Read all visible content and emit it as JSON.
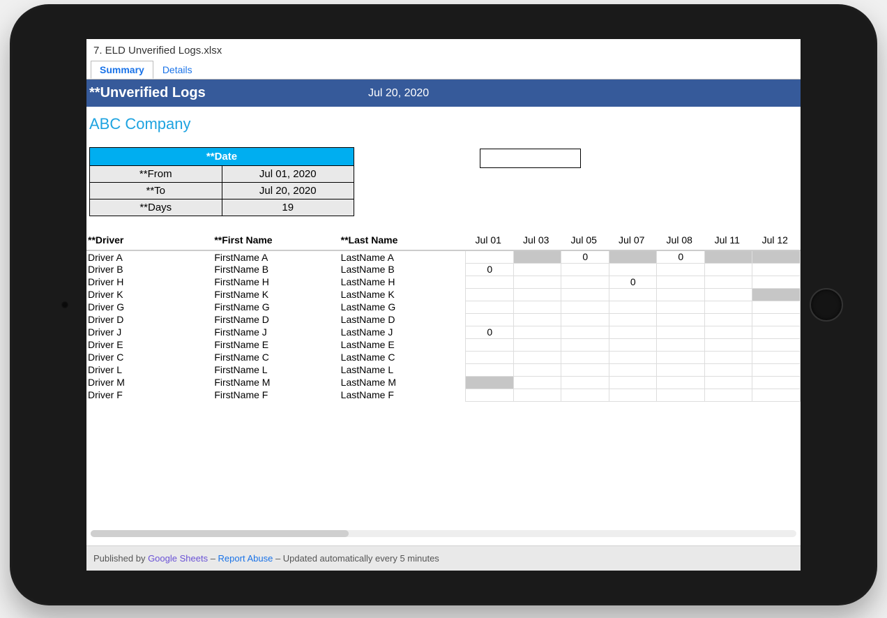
{
  "doc_title": "7. ELD Unverified Logs.xlsx",
  "tabs": {
    "summary": "Summary",
    "details": "Details"
  },
  "header": {
    "title": "**Unverified Logs",
    "date": "Jul 20, 2020"
  },
  "company": "ABC Company",
  "date_table": {
    "header": "**Date",
    "from_label": "**From",
    "from_value": "Jul 01, 2020",
    "to_label": "**To",
    "to_value": "Jul 20, 2020",
    "days_label": "**Days",
    "days_value": "19"
  },
  "grid": {
    "headers": {
      "driver": "**Driver",
      "first": "**First Name",
      "last": "**Last Name",
      "dates": [
        "Jul 01",
        "Jul 03",
        "Jul 05",
        "Jul 07",
        "Jul 08",
        "Jul 11",
        "Jul 12"
      ]
    },
    "rows": [
      {
        "driver": "Driver A",
        "first": "FirstName A",
        "last": "LastName A",
        "cells": [
          {
            "v": ""
          },
          {
            "v": "",
            "s": true
          },
          {
            "v": "0"
          },
          {
            "v": "",
            "s": true
          },
          {
            "v": "0"
          },
          {
            "v": "",
            "s": true
          },
          {
            "v": "",
            "s": true
          }
        ]
      },
      {
        "driver": "Driver B",
        "first": "FirstName B",
        "last": "LastName B",
        "cells": [
          {
            "v": "0"
          },
          {
            "v": ""
          },
          {
            "v": ""
          },
          {
            "v": ""
          },
          {
            "v": ""
          },
          {
            "v": ""
          },
          {
            "v": ""
          }
        ]
      },
      {
        "driver": "Driver H",
        "first": "FirstName H",
        "last": "LastName H",
        "cells": [
          {
            "v": ""
          },
          {
            "v": ""
          },
          {
            "v": ""
          },
          {
            "v": "0"
          },
          {
            "v": ""
          },
          {
            "v": ""
          },
          {
            "v": ""
          }
        ]
      },
      {
        "driver": "Driver K",
        "first": "FirstName K",
        "last": "LastName K",
        "cells": [
          {
            "v": ""
          },
          {
            "v": ""
          },
          {
            "v": ""
          },
          {
            "v": ""
          },
          {
            "v": ""
          },
          {
            "v": ""
          },
          {
            "v": "",
            "s": true
          }
        ]
      },
      {
        "driver": "Driver G",
        "first": "FirstName G",
        "last": "LastName G",
        "cells": [
          {
            "v": ""
          },
          {
            "v": ""
          },
          {
            "v": ""
          },
          {
            "v": ""
          },
          {
            "v": ""
          },
          {
            "v": ""
          },
          {
            "v": ""
          }
        ]
      },
      {
        "driver": "Driver D",
        "first": "FirstName D",
        "last": "LastName D",
        "cells": [
          {
            "v": ""
          },
          {
            "v": ""
          },
          {
            "v": ""
          },
          {
            "v": ""
          },
          {
            "v": ""
          },
          {
            "v": ""
          },
          {
            "v": ""
          }
        ]
      },
      {
        "driver": "Driver J",
        "first": "FirstName J",
        "last": "LastName J",
        "cells": [
          {
            "v": "0"
          },
          {
            "v": ""
          },
          {
            "v": ""
          },
          {
            "v": ""
          },
          {
            "v": ""
          },
          {
            "v": ""
          },
          {
            "v": ""
          }
        ]
      },
      {
        "driver": "Driver E",
        "first": "FirstName E",
        "last": "LastName E",
        "cells": [
          {
            "v": ""
          },
          {
            "v": ""
          },
          {
            "v": ""
          },
          {
            "v": ""
          },
          {
            "v": ""
          },
          {
            "v": ""
          },
          {
            "v": ""
          }
        ]
      },
      {
        "driver": "Driver C",
        "first": "FirstName C",
        "last": "LastName C",
        "cells": [
          {
            "v": ""
          },
          {
            "v": ""
          },
          {
            "v": ""
          },
          {
            "v": ""
          },
          {
            "v": ""
          },
          {
            "v": ""
          },
          {
            "v": ""
          }
        ]
      },
      {
        "driver": "Driver L",
        "first": "FirstName L",
        "last": "LastName L",
        "cells": [
          {
            "v": ""
          },
          {
            "v": ""
          },
          {
            "v": ""
          },
          {
            "v": ""
          },
          {
            "v": ""
          },
          {
            "v": ""
          },
          {
            "v": ""
          }
        ]
      },
      {
        "driver": "Driver M",
        "first": "FirstName M",
        "last": "LastName M",
        "cells": [
          {
            "v": "",
            "s": true
          },
          {
            "v": ""
          },
          {
            "v": ""
          },
          {
            "v": ""
          },
          {
            "v": ""
          },
          {
            "v": ""
          },
          {
            "v": ""
          }
        ]
      },
      {
        "driver": "Driver F",
        "first": "FirstName F",
        "last": "LastName F",
        "cells": [
          {
            "v": ""
          },
          {
            "v": ""
          },
          {
            "v": ""
          },
          {
            "v": ""
          },
          {
            "v": ""
          },
          {
            "v": ""
          },
          {
            "v": ""
          }
        ]
      }
    ]
  },
  "footer": {
    "published_by": "Published by ",
    "link1": "Google Sheets",
    "sep": "  –  ",
    "link2": "Report Abuse",
    "updated": "Updated automatically every 5 minutes"
  }
}
